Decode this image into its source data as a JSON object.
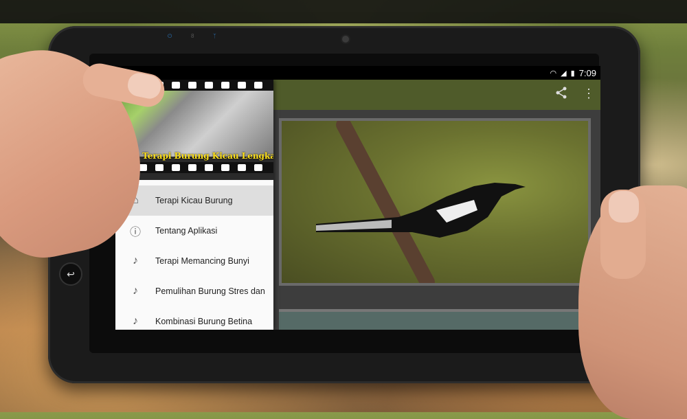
{
  "status_bar": {
    "time": "7:09"
  },
  "drawer": {
    "header_title": "Audio Terapi Burung Kicau Lengkap OffLine",
    "items": [
      {
        "label": "Terapi Kicau Burung",
        "icon": "home-icon",
        "active": true
      },
      {
        "label": "Tentang Aplikasi",
        "icon": "info-icon",
        "active": false
      },
      {
        "label": "Terapi Memancing Bunyi",
        "icon": "music-note-icon",
        "active": false
      },
      {
        "label": "Pemulihan Burung Stres dan",
        "icon": "music-note-icon",
        "active": false
      },
      {
        "label": "Kombinasi Burung Betina",
        "icon": "music-note-icon",
        "active": false
      }
    ]
  },
  "app_bar": {
    "actions": [
      "share-icon",
      "overflow-menu-icon"
    ]
  },
  "colors": {
    "app_bar": "#4f5b2a",
    "header_title": "#ffe11a",
    "active_item": "#dedede"
  }
}
